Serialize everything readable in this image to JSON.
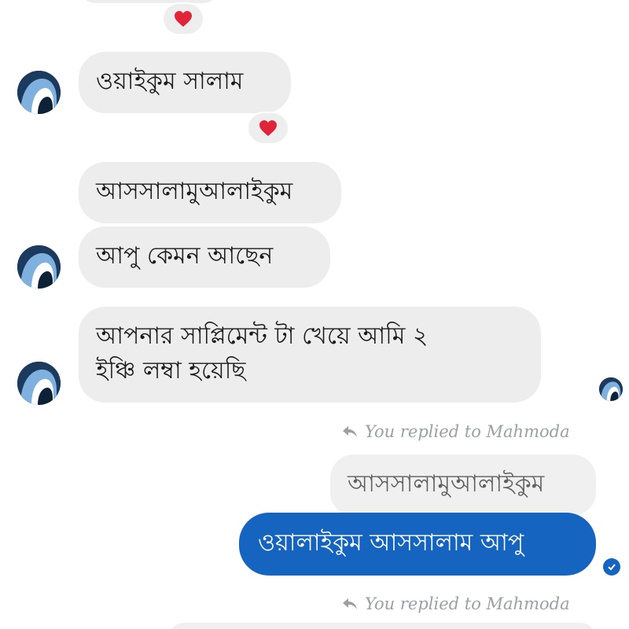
{
  "messages": [
    {
      "id": "m1",
      "direction": "incoming",
      "text": "ওয়াইকুম সালাম",
      "reaction": "heart-icon"
    },
    {
      "id": "m2",
      "direction": "incoming",
      "text": "আসসালামুআলাইকুম"
    },
    {
      "id": "m3",
      "direction": "incoming",
      "text": "আপু কেমন আছেন"
    },
    {
      "id": "m4",
      "direction": "incoming",
      "lines": [
        "আপনার সাপ্লিমেন্ট টা খেয়ে আমি ২",
        "ইঞ্চি লম্বা হয়েছি"
      ]
    },
    {
      "id": "m5",
      "direction": "outgoing",
      "reply_note": "You replied to Mahmoda",
      "quoted_text": "আসসালামুআলাইকুম",
      "text": "ওয়ালাইকুম আসসালাম আপু"
    }
  ],
  "reply_note_bottom": "You replied to Mahmoda",
  "colors": {
    "incoming_bubble": "#ededed",
    "outgoing_bubble": "#1565c0",
    "reaction_heart": "#e0253a",
    "reply_note": "#9aa0a6"
  }
}
